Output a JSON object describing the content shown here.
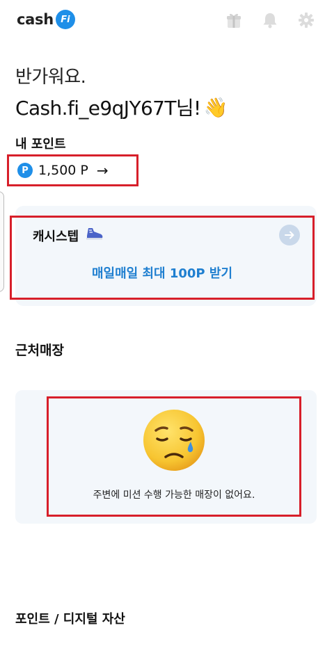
{
  "header": {
    "logo_text": "cash",
    "logo_badge": "Fi",
    "icons": [
      "gift-icon",
      "bell-icon",
      "gear-icon"
    ]
  },
  "greeting": {
    "line1": "반가워요.",
    "username": "Cash.fi_e9qJY67T님!",
    "emoji": "👋"
  },
  "points": {
    "label": "내 포인트",
    "icon_letter": "P",
    "value": "1,500 P",
    "arrow": "→"
  },
  "cash_step": {
    "title": "캐시스텝",
    "cta": "매일매일 최대 100P 받기"
  },
  "nearby": {
    "title": "근처매장",
    "empty_message": "주변에 미션 수행 가능한 매장이 없어요."
  },
  "assets": {
    "title": "포인트 / 디지털 자산"
  },
  "colors": {
    "brand_blue": "#1f8fe8",
    "cta_blue": "#1f7fd0",
    "highlight_red": "#d71f2a",
    "card_bg": "#f3f7fb"
  }
}
